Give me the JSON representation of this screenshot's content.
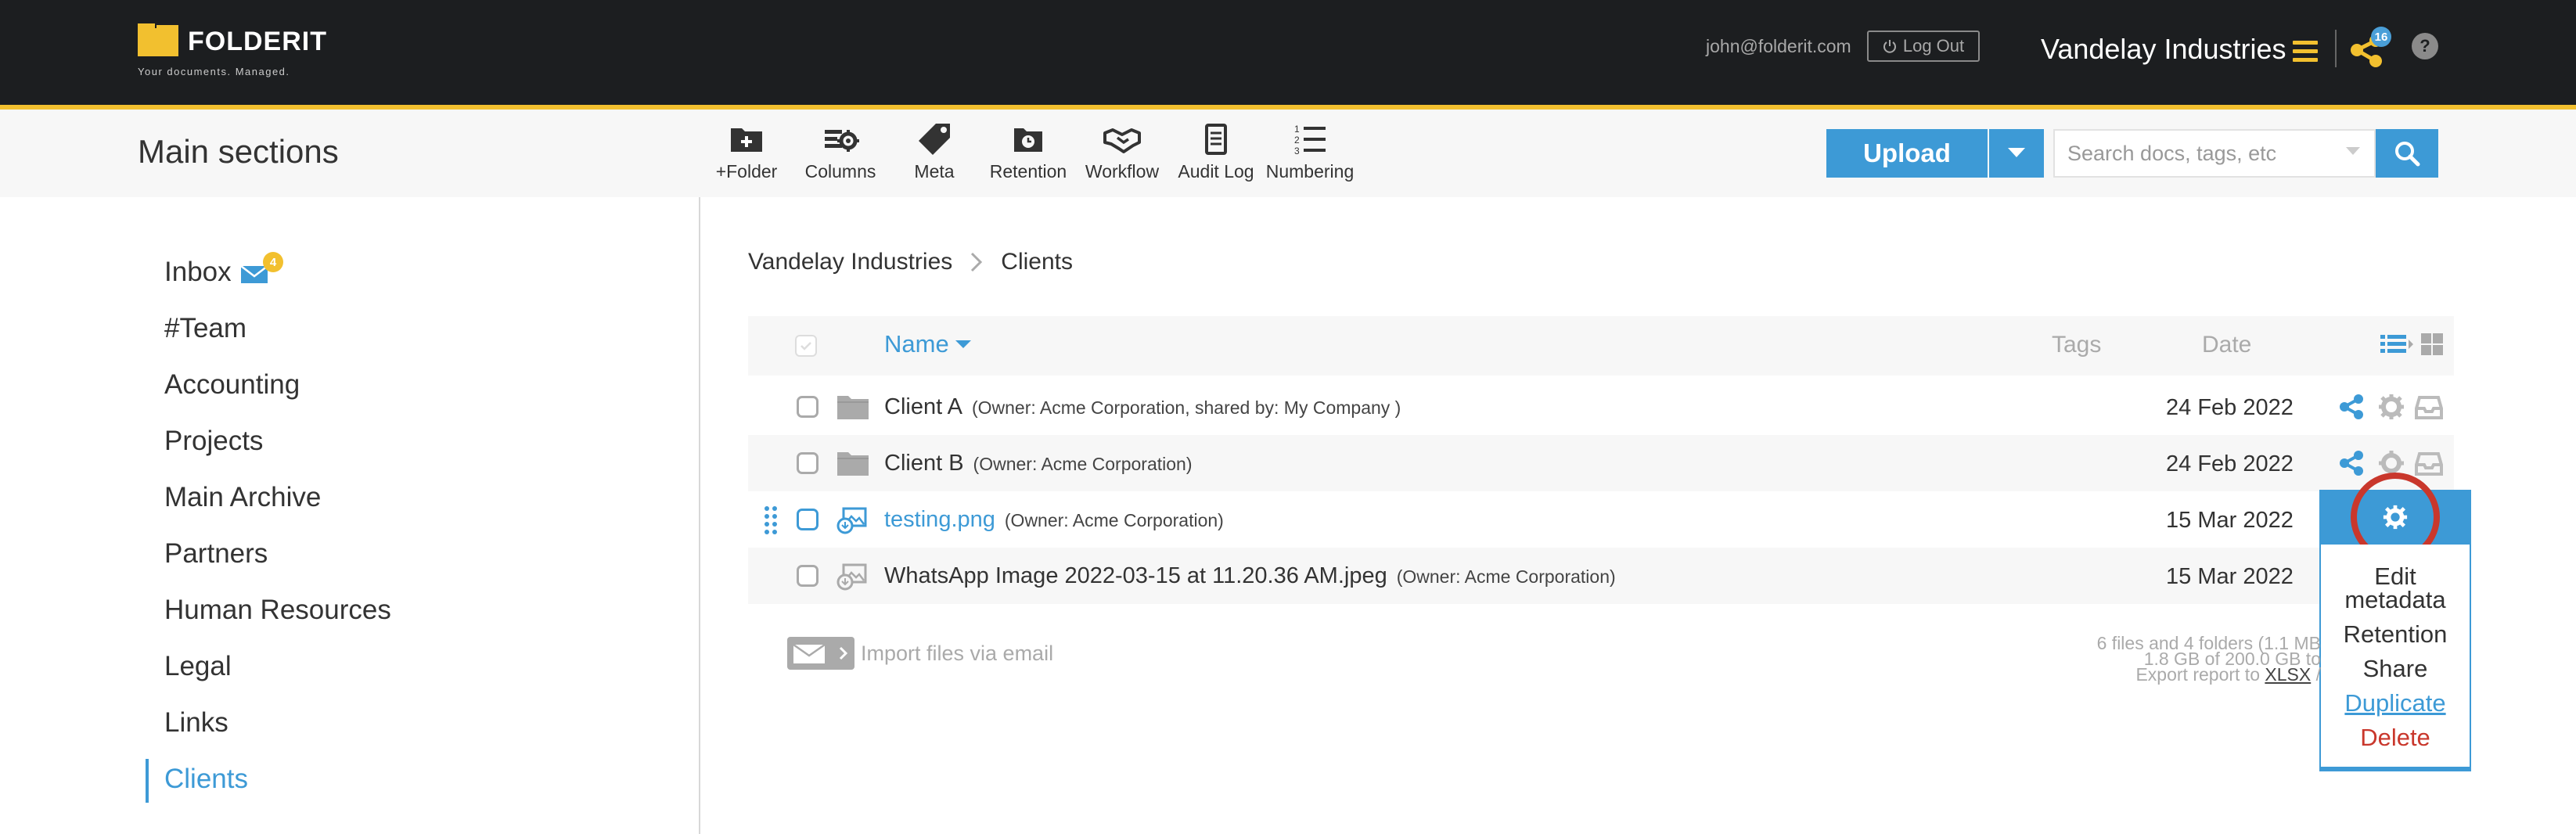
{
  "header": {
    "logo_text": "FOLDERIT",
    "logo_tagline": "Your documents. Managed.",
    "user_email": "john@folderit.com",
    "logout_label": "Log Out",
    "company": "Vandelay Industries",
    "share_count": "16",
    "help_label": "?"
  },
  "toolbar": {
    "section_title": "Main sections",
    "tools": [
      {
        "label": "+Folder",
        "icon": "folder-plus-icon"
      },
      {
        "label": "Columns",
        "icon": "columns-gear-icon"
      },
      {
        "label": "Meta",
        "icon": "tag-icon"
      },
      {
        "label": "Retention",
        "icon": "retention-folder-icon"
      },
      {
        "label": "Workflow",
        "icon": "handshake-icon"
      },
      {
        "label": "Audit Log",
        "icon": "document-list-icon"
      },
      {
        "label": "Numbering",
        "icon": "numbered-list-icon"
      }
    ],
    "upload_label": "Upload",
    "search_placeholder": "Search docs, tags, etc"
  },
  "sidebar": {
    "inbox_badge": "4",
    "items": [
      {
        "label": "Inbox"
      },
      {
        "label": "#Team"
      },
      {
        "label": "Accounting"
      },
      {
        "label": "Projects"
      },
      {
        "label": "Main Archive"
      },
      {
        "label": "Partners"
      },
      {
        "label": "Human Resources"
      },
      {
        "label": "Legal"
      },
      {
        "label": "Links"
      },
      {
        "label": "Clients"
      }
    ],
    "active_item": "Clients"
  },
  "breadcrumb": [
    "Vandelay Industries",
    "Clients"
  ],
  "table": {
    "columns": {
      "name": "Name",
      "tags": "Tags",
      "date": "Date"
    },
    "rows": [
      {
        "name": "Client A",
        "owner": "(Owner: Acme Corporation, shared by: My Company )",
        "date": "24 Feb 2022",
        "type": "folder"
      },
      {
        "name": "Client B",
        "owner": "(Owner: Acme Corporation)",
        "date": "24 Feb 2022",
        "type": "folder"
      },
      {
        "name": "testing.png",
        "owner": "(Owner: Acme Corporation)",
        "date": "15 Mar 2022",
        "type": "image"
      },
      {
        "name": "WhatsApp Image 2022-03-15 at 11.20.36 AM.jpeg",
        "owner": "(Owner: Acme Corporation)",
        "date": "15 Mar 2022",
        "type": "image"
      }
    ]
  },
  "context_menu": {
    "items": [
      "Edit metadata",
      "Retention",
      "Share",
      "Duplicate",
      "Delete"
    ]
  },
  "footer": {
    "import_label": "Import files via email",
    "stats_line1": "6 files and 4 folders (1.1 MB",
    "stats_line2": "1.8 GB of 200.0 GB to",
    "stats_line3_prefix": "Export report to",
    "stats_xlsx": "XLSX",
    "stats_line3_suffix": "/"
  },
  "colors": {
    "accent": "#3d9ad6",
    "brand_yellow": "#f2c02f",
    "topbar_bg": "#1c1e20",
    "danger": "#c9372c"
  }
}
